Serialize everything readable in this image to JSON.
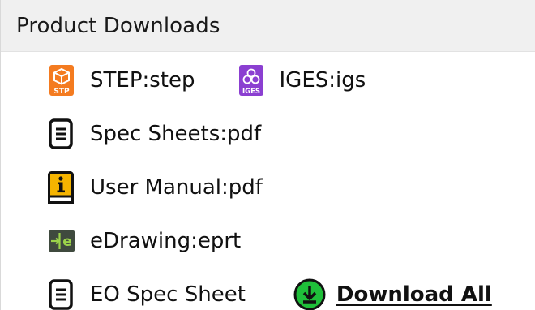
{
  "header": {
    "title": "Product Downloads"
  },
  "downloads": {
    "step": {
      "label": "STEP:step",
      "icon": "step-file-icon",
      "color": "#f47b20"
    },
    "iges": {
      "label": "IGES:igs",
      "icon": "iges-file-icon",
      "color": "#8b3fd1"
    },
    "spec_sheets": {
      "label": "Spec Sheets:pdf",
      "icon": "document-icon"
    },
    "user_manual": {
      "label": "User Manual:pdf",
      "icon": "info-book-icon",
      "color": "#f5b400"
    },
    "edrawing": {
      "label": "eDrawing:eprt",
      "icon": "edrawing-icon",
      "color": "#3f4a3e"
    },
    "eo_spec_sheet": {
      "label": "EO Spec Sheet",
      "icon": "document-icon"
    },
    "download_all": {
      "label": "Download All",
      "icon": "download-circle-icon",
      "color": "#1fbf3a"
    }
  }
}
